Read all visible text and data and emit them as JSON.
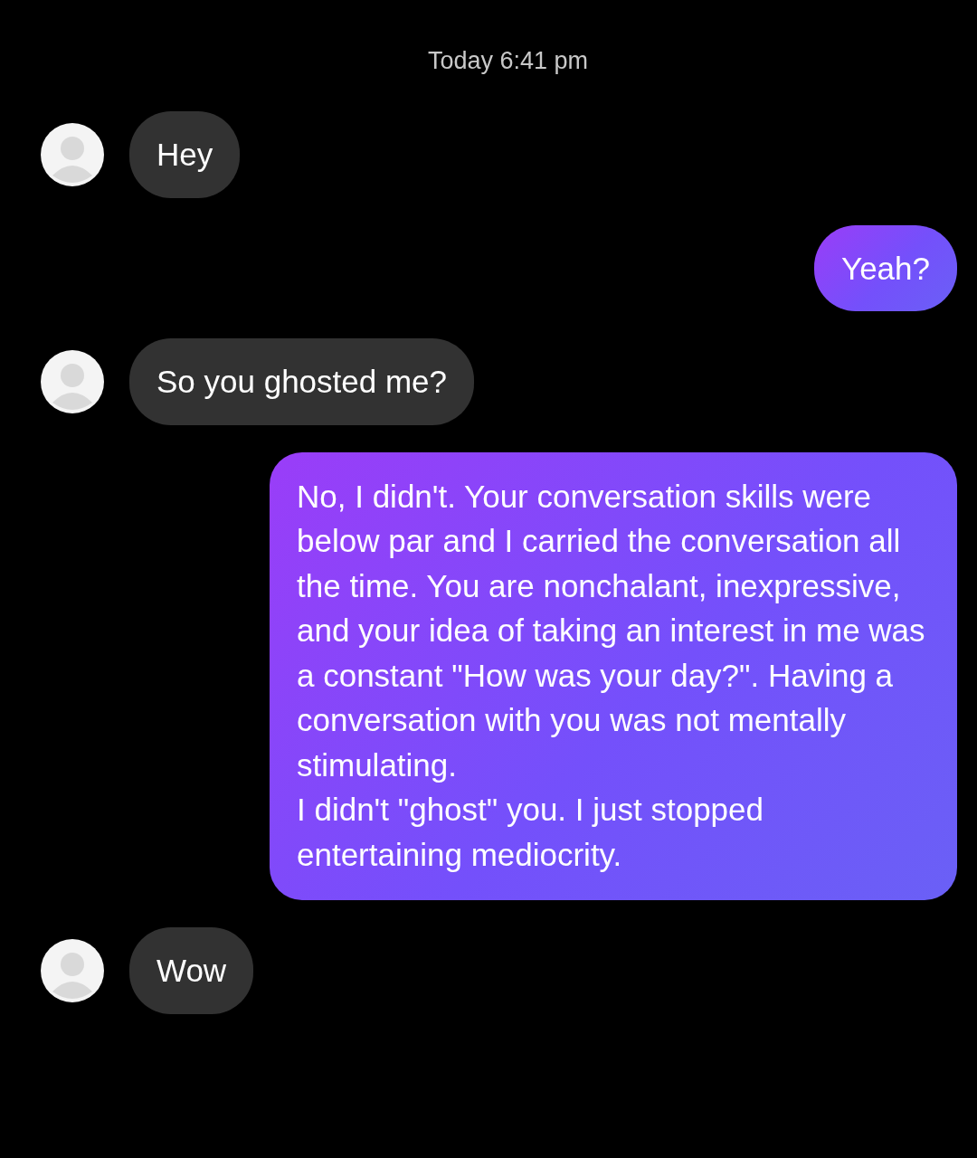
{
  "timestamp": "Today 6:41 pm",
  "messages": [
    {
      "kind": "incoming",
      "text": "Hey"
    },
    {
      "kind": "outgoing",
      "text": "Yeah?"
    },
    {
      "kind": "incoming",
      "text": "So you ghosted me?"
    },
    {
      "kind": "outgoing",
      "text": "No, I didn't. Your conversation skills were below par and I carried the conversation all the time. You are nonchalant, inexpressive, and your idea of taking an interest in me was a constant \"How was your day?\". Having a conversation with you was not mentally stimulating.\nI didn't \"ghost\" you. I just stopped entertaining mediocrity."
    },
    {
      "kind": "incoming",
      "text": "Wow"
    }
  ]
}
